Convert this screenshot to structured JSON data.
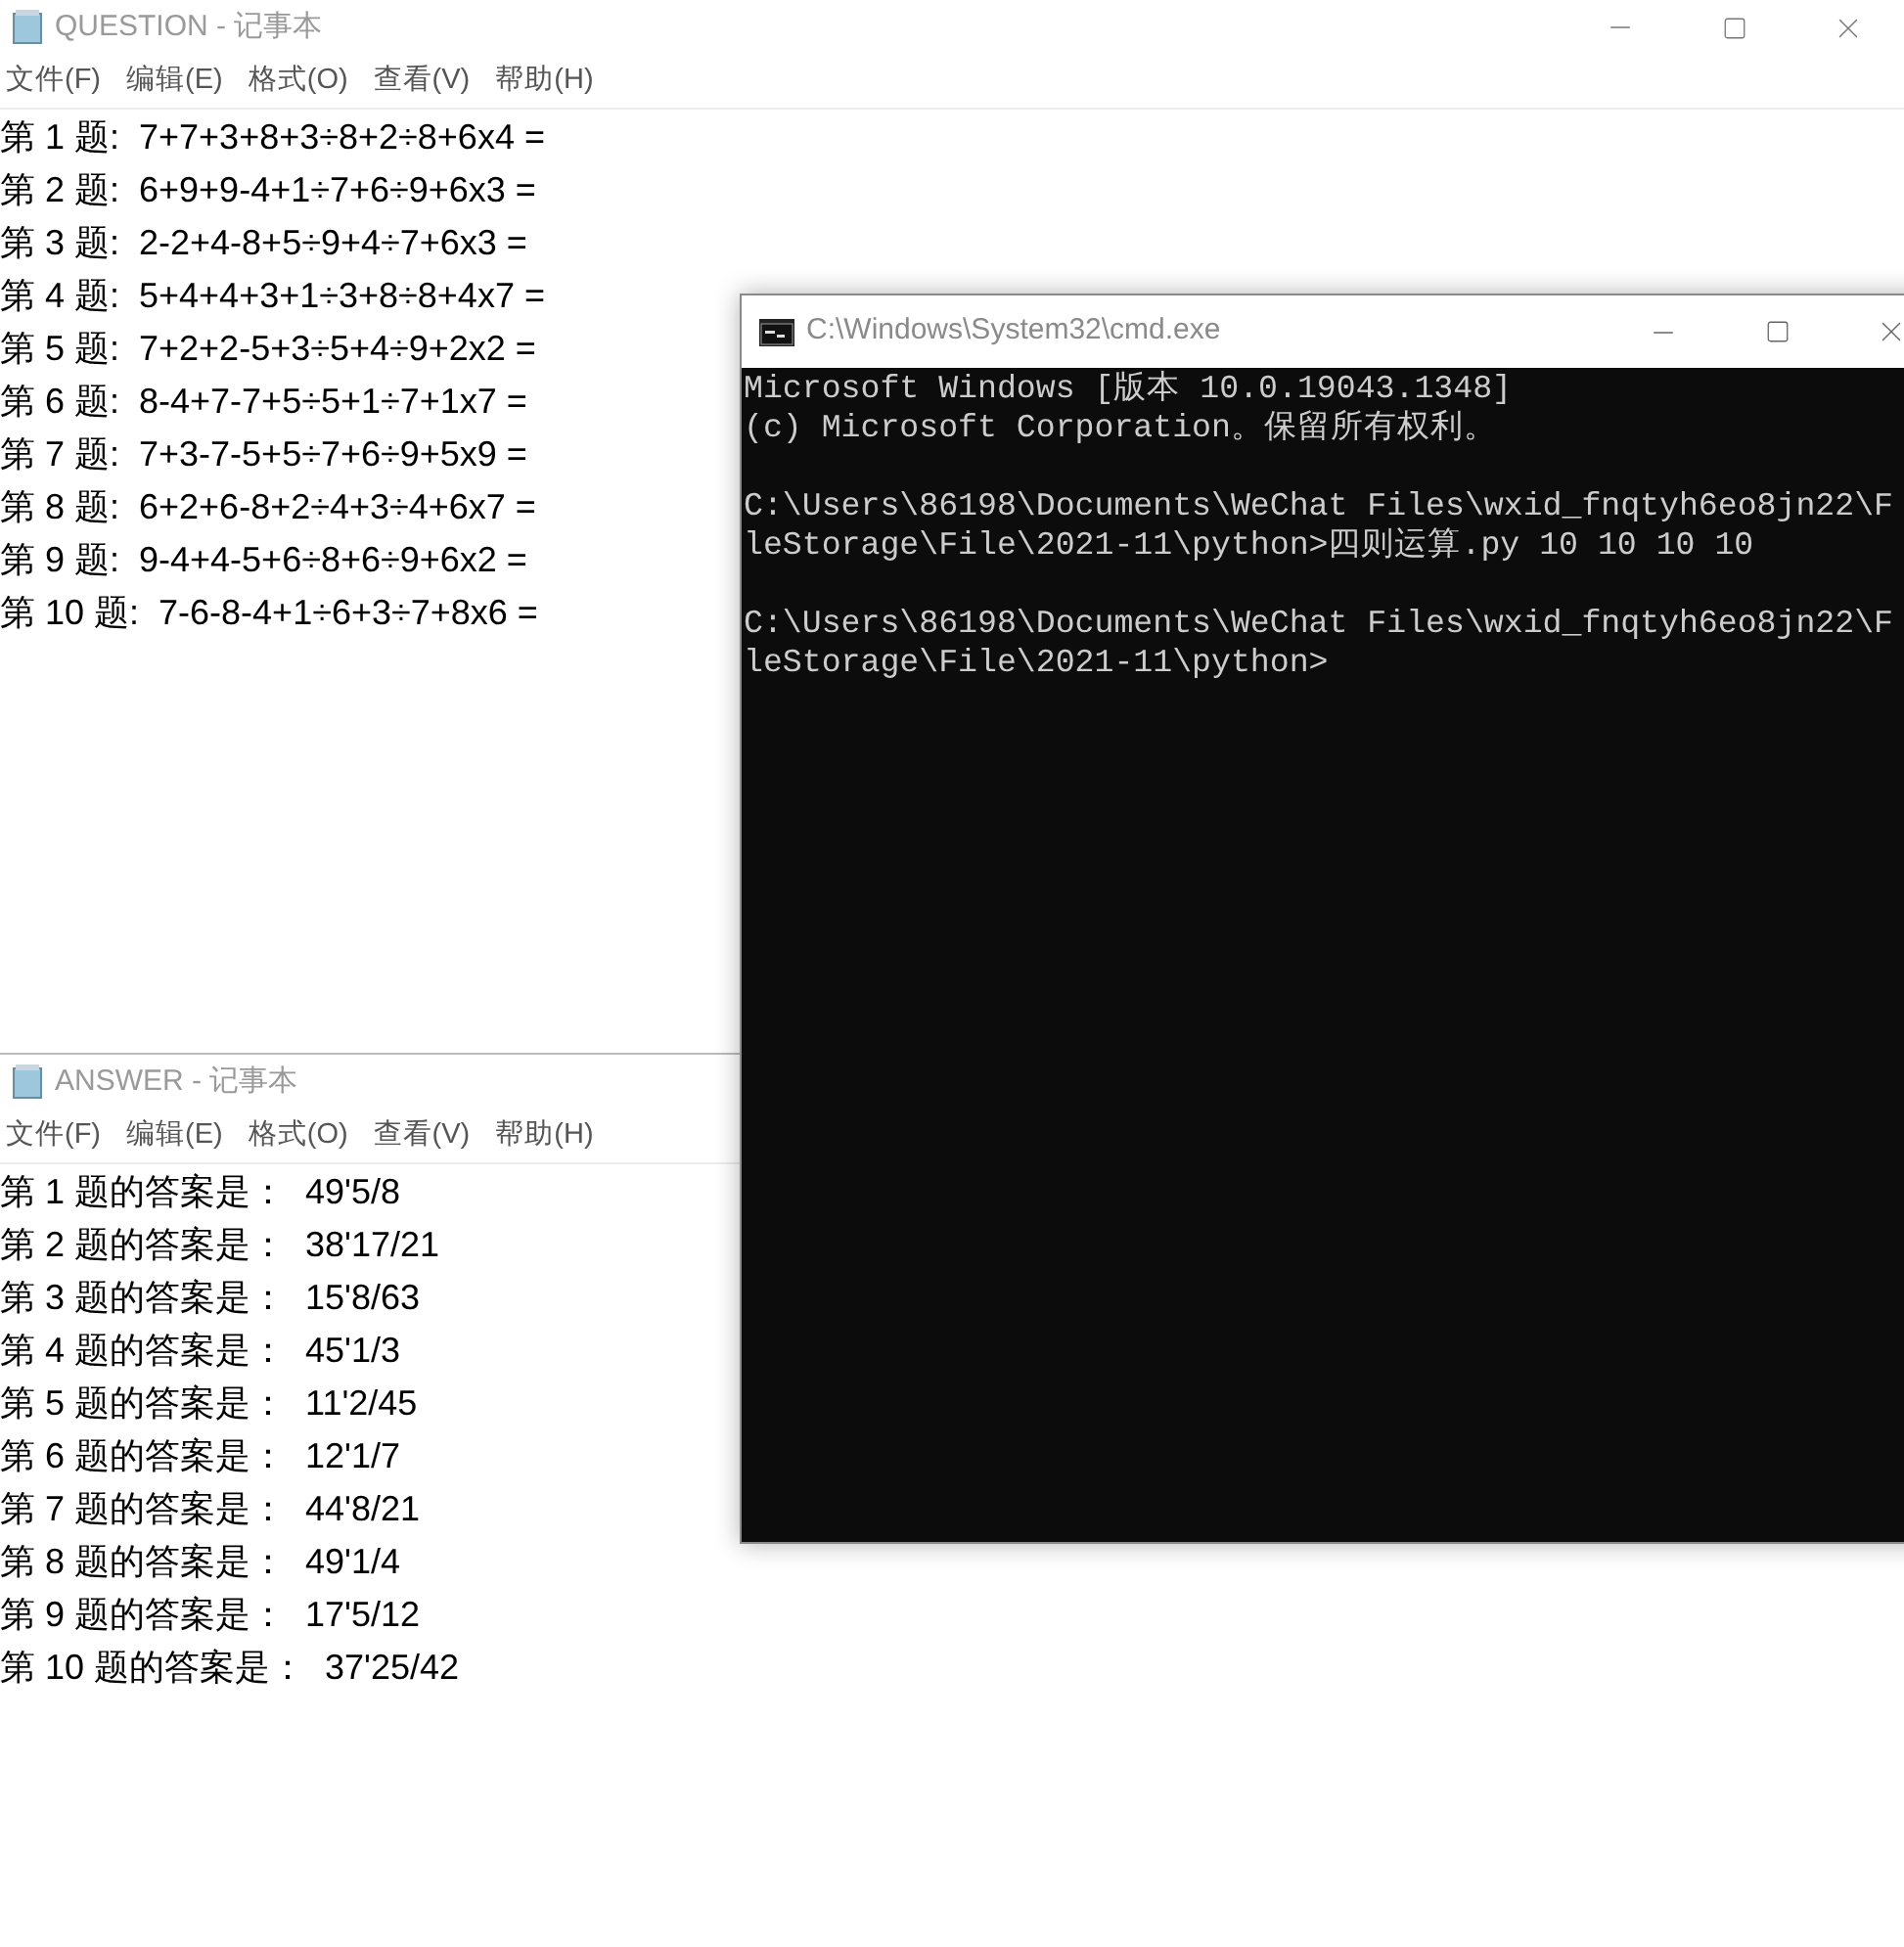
{
  "question_window": {
    "title": "QUESTION - 记事本",
    "menu": [
      "文件(F)",
      "编辑(E)",
      "格式(O)",
      "查看(V)",
      "帮助(H)"
    ],
    "lines": [
      "第 1 题:  7+7+3+8+3÷8+2÷8+6x4 =",
      "第 2 题:  6+9+9-4+1÷7+6÷9+6x3 =",
      "第 3 题:  2-2+4-8+5÷9+4÷7+6x3 =",
      "第 4 题:  5+4+4+3+1÷3+8÷8+4x7 =",
      "第 5 题:  7+2+2-5+3÷5+4÷9+2x2 =",
      "第 6 题:  8-4+7-7+5÷5+1÷7+1x7 =",
      "第 7 题:  7+3-7-5+5÷7+6÷9+5x9 =",
      "第 8 题:  6+2+6-8+2÷4+3÷4+6x7 =",
      "第 9 题:  9-4+4-5+6÷8+6÷9+6x2 =",
      "第 10 题:  7-6-8-4+1÷6+3÷7+8x6 ="
    ]
  },
  "answer_window": {
    "title": "ANSWER - 记事本",
    "menu": [
      "文件(F)",
      "编辑(E)",
      "格式(O)",
      "查看(V)",
      "帮助(H)"
    ],
    "lines": [
      "第 1 题的答案是：  49'5/8",
      "第 2 题的答案是：  38'17/21",
      "第 3 题的答案是：  15'8/63",
      "第 4 题的答案是：  45'1/3",
      "第 5 题的答案是：  11'2/45",
      "第 6 题的答案是：  12'1/7",
      "第 7 题的答案是：  44'8/21",
      "第 8 题的答案是：  49'1/4",
      "第 9 题的答案是：  17'5/12",
      "第 10 题的答案是：  37'25/42"
    ]
  },
  "cmd_window": {
    "title": "C:\\Windows\\System32\\cmd.exe",
    "blocks": [
      [
        "Microsoft Windows [版本 10.0.19043.1348]",
        "(c) Microsoft Corporation。保留所有权利。"
      ],
      [
        "C:\\Users\\86198\\Documents\\WeChat Files\\wxid_fnqtyh6eo8jn22\\F",
        "leStorage\\File\\2021-11\\python>四则运算.py 10 10 10 10"
      ],
      [
        "C:\\Users\\86198\\Documents\\WeChat Files\\wxid_fnqtyh6eo8jn22\\F",
        "leStorage\\File\\2021-11\\python>"
      ]
    ]
  }
}
